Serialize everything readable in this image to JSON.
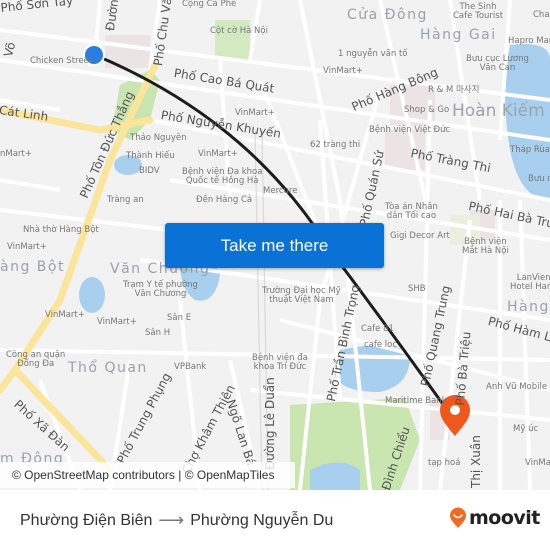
{
  "map": {
    "cta_label": "Take me there",
    "attribution": "© OpenStreetMap contributors | © OpenMapTiles",
    "colors": {
      "route_line": "#1c1c1c",
      "origin_marker": "#2a7de1",
      "destination_marker": "#f0581b",
      "cta_background": "#0a72d6",
      "water": "#a8d0ee",
      "park": "#c9e5b0",
      "major_road": "#fbe59a"
    },
    "street_labels": {
      "son_tay": "Phố Sơn Tây",
      "duong": "Đường",
      "chu_van": "Phố Chu Văn",
      "cao_ba_quat": "Phố Cao Bá Quát",
      "cat_linh": "Cát Linh",
      "cat_linh2": "at Linh",
      "nguyen_khuyen": "Phố Nguyễn Khuyến",
      "ton_duc_thang": "Phố Tôn Đức Thắng",
      "hang_bong": "Phố Hàng Bông",
      "trang_thi": "Phố Tràng Thi",
      "hai_ba_trung": "Phố Hai Bà Trưng",
      "quan_su": "Phố Quán Sứ",
      "tran_binh_trong": "Phố Trần Bình Trọng",
      "quang_trung": "Phố Quang Trung",
      "ba_trieu": "Phố Bà Triệu",
      "ham_long": "Phố Hàm Long",
      "trung_phung": "Phố Trung Phụng",
      "cho_kham_thien": "Chợ Khâm Thiên",
      "ngo_lan_ba": "Ngõ Lan Bá",
      "le_duan": "Đường Lê Duẩn",
      "xa_dan": "Phố Xã Đàn",
      "dinh_chieu": "Đình Chiểu",
      "thi_xuan": "Thị Xuân",
      "vo": "Võ"
    },
    "area_labels": {
      "cua_dong": "Cửa Đông",
      "hang_gai": "Hàng Gai",
      "hoan_kiem": "Hoàn Kiếm",
      "hang_bot": "àng Bột",
      "van_chuong": "Văn Chương",
      "tho_quan": "Thổ Quan",
      "hang_bai": "Hàng B",
      "dong": "m Đông"
    },
    "poi_labels": {
      "cong_ca_phe": "Cộng Cà Phê",
      "cot_co": "Cột cờ Hà Nội",
      "chicken_street": "Chicken Street",
      "the_sinh": "The Sinh\nCafe Tourist",
      "cha": "Cha",
      "hapro": "Hapro Mar",
      "nguyen_van_to": "1 nguyễn văn tố",
      "vinmart_1": "VinMart+",
      "buu_cuc": "Bưu cục Lương\nVăn Can",
      "rm": "R & M 마사지",
      "shop_go": "Shop & Go",
      "viet_duc": "Bệnh viện Việt Đức",
      "vinmart_2": "VinMart+",
      "thao_nguyen": "Thảo Nguyên",
      "vinmart_3": "nMart+",
      "thanh_hieu": "Thành Hiếu",
      "bidv": "BIDV",
      "vinmart_4": "VinMart+",
      "hong_ha": "Bệnh viện Đa khoa\nQuốc tế Hồng Hà",
      "mercure": "Mercure",
      "den_hang_ca": "Đền Hàng Cả",
      "trang_an": "Tràng an",
      "62_trang_thi": "62 tràng thi",
      "thap_rua": "Tháp Rùa",
      "buu_d": "Bưu đ",
      "toa_an": "Tòa án Nhân\ndân Tối cao",
      "gigi": "Gigi Decor Art",
      "mat_ha_noi": "Bệnh viện\nMắt Hà Nội",
      "nha_tho": "Nhà thờ Hàng Bột",
      "vinmart_5": "VinMart+",
      "lanvien": "LanVien\nHotel Hano",
      "shb": "SHB",
      "tram_yte": "Trạm Y tế phường\nVăn Chương",
      "my_thuat": "Trường Đại học Mỹ\nthuật Việt Nam",
      "vinmart_6": "VinMart+",
      "vinmart_7": "VinMart+",
      "san_e": "Sân E",
      "san_h": "Sân H",
      "cafe_81": "Cafe 81",
      "cafe_loc": "cafe loc",
      "cong_an": "Công an quận\nĐống Đa",
      "vpbank": "VPBank",
      "tri_duc": "Bệnh viện đa\nkhoa Trí Đức",
      "anh_vu": "Anh Vũ Mobile",
      "maritime": "Maritime Bank",
      "my_uc": "Mỹ úc",
      "vinmart_8": "VinMa",
      "tap_hoa": "tạp hoá"
    }
  },
  "footer": {
    "origin": "Phường Điện Biên",
    "arrow": "⟶",
    "destination": "Phường Nguyễn Du",
    "logo_text": "moovit",
    "logo_color": "#f26a20"
  }
}
